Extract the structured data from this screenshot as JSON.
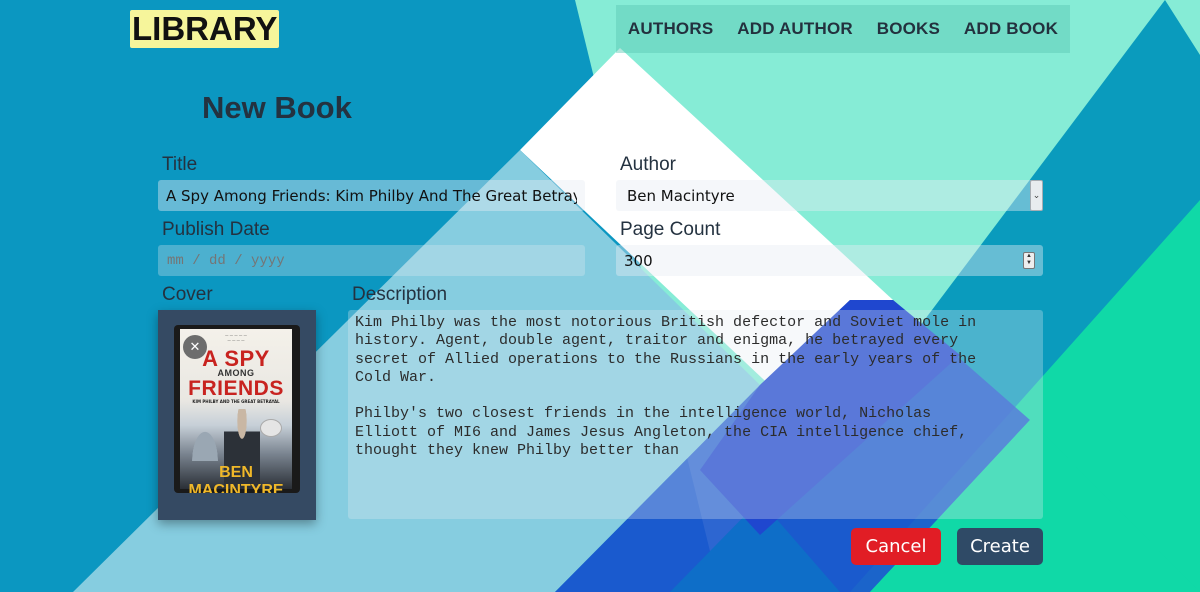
{
  "brand": {
    "logo": "LIBRARY"
  },
  "nav": {
    "items": [
      {
        "label": "AUTHORS"
      },
      {
        "label": "ADD AUTHOR"
      },
      {
        "label": "BOOKS"
      },
      {
        "label": "ADD BOOK"
      }
    ]
  },
  "page": {
    "title": "New Book"
  },
  "form": {
    "title": {
      "label": "Title",
      "value": "A Spy Among Friends: Kim Philby And The Great Betrayal"
    },
    "author": {
      "label": "Author",
      "selected": "Ben Macintyre"
    },
    "publish_date": {
      "label": "Publish Date",
      "placeholder": "mm / dd / yyyy"
    },
    "page_count": {
      "label": "Page Count",
      "value": "300"
    },
    "cover": {
      "label": "Cover",
      "remove_icon": "close-icon",
      "book_title_line1": "A SPY",
      "book_title_line2": "AMONG",
      "book_title_line3": "FRIENDS",
      "book_subtitle": "KIM PHILBY AND THE GREAT BETRAYAL",
      "book_author": "BEN MACINTYRE"
    },
    "description": {
      "label": "Description",
      "value": "Kim Philby was the most notorious British defector and Soviet mole in\nhistory. Agent, double agent, traitor and enigma, he betrayed every\nsecret of Allied operations to the Russians in the early years of the\nCold War.\n\nPhilby's two closest friends in the intelligence world, Nicholas\nElliott of MI6 and James Jesus Angleton, the CIA intelligence chief,\nthought they knew Philby better than"
    }
  },
  "actions": {
    "cancel": "Cancel",
    "create": "Create"
  },
  "colors": {
    "background": "#0b97c1",
    "logo_bg": "#f6f59b",
    "cancel_button": "#e11d25",
    "create_button": "#2f4a66",
    "cover_frame": "#354a63"
  }
}
